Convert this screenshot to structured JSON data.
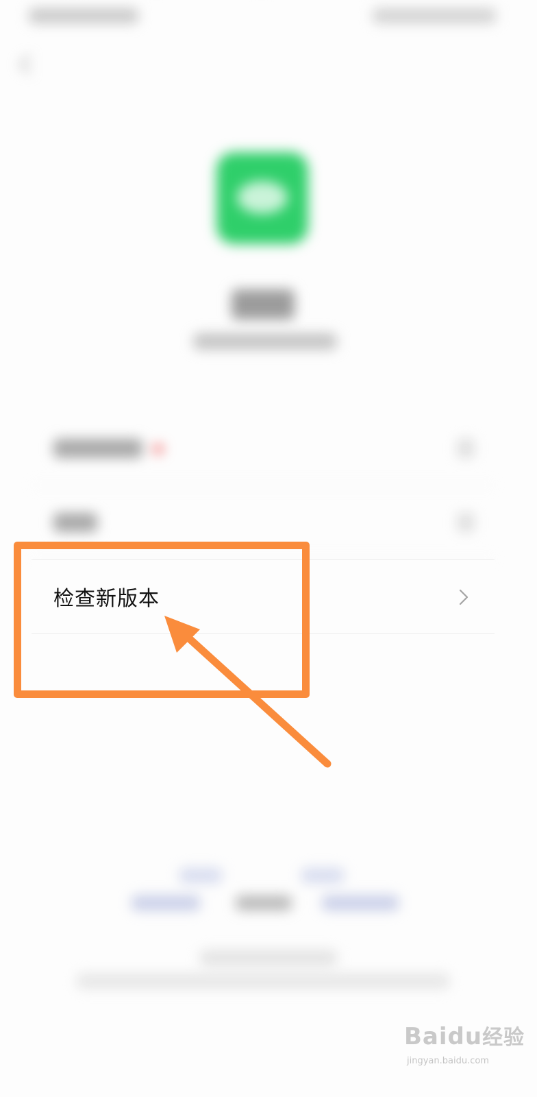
{
  "check_update": {
    "label": "检查新版本"
  },
  "colors": {
    "annotation_orange": "#fa8c3c",
    "app_green": "#2fcf6a",
    "badge_red": "#f26a6a",
    "text_primary": "#111111"
  },
  "watermark": {
    "brand": "Bai",
    "brand_suffix": "du",
    "brand_cn": "经验",
    "url": "jingyan.baidu.com"
  },
  "icons": {
    "back": "chevron-left-icon",
    "row_chevron": "chevron-right-icon",
    "annotation_arrow": "arrow-icon",
    "app_logo": "app-logo-icon"
  }
}
